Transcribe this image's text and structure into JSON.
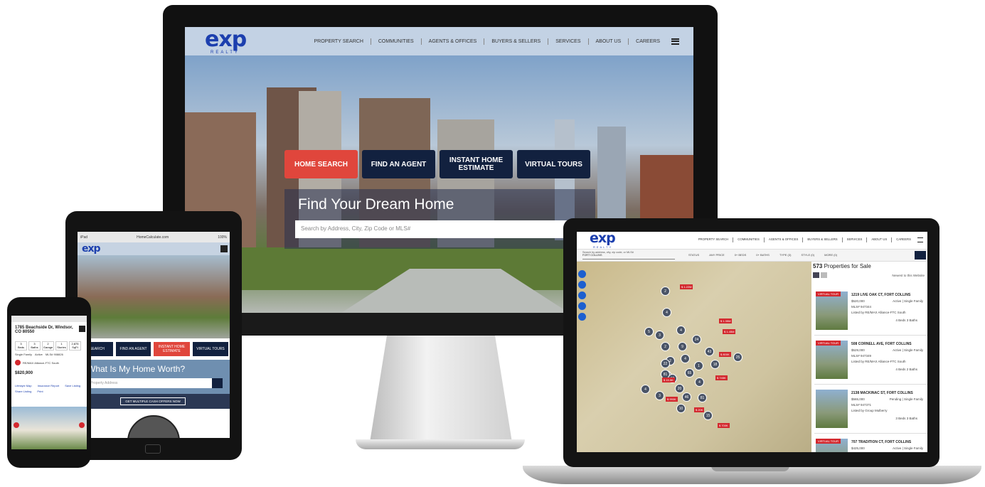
{
  "desktop": {
    "logo": "exp",
    "logo_sub": "REALTY",
    "nav": [
      "PROPERTY SEARCH",
      "COMMUNITIES",
      "AGENTS & OFFICES",
      "BUYERS & SELLERS",
      "SERVICES",
      "ABOUT US",
      "CAREERS"
    ],
    "tabs": [
      "HOME SEARCH",
      "FIND AN AGENT",
      "INSTANT HOME ESTIMATE",
      "VIRTUAL TOURS"
    ],
    "heading": "Find Your Dream Home",
    "search_placeholder": "Search by Address, City, Zip Code or MLS#"
  },
  "tablet": {
    "status": "iPad",
    "url": "HomeCalculate.com",
    "battery": "100%",
    "logo": "exp",
    "tabs": [
      "R SEARCH",
      "FIND AN AGENT",
      "INSTANT HOME ESTIMATE",
      "VIRTUAL TOURS"
    ],
    "heading": "What Is My Home Worth?",
    "input_placeholder": "Property Address",
    "offers_button": "GET MULTIPLE CASH OFFERS NOW"
  },
  "phone": {
    "address": "1785 Beachside Dr, Windsor, CO 80550",
    "stats": [
      {
        "v": "3",
        "l": "Beds"
      },
      {
        "v": "3",
        "l": "Baths"
      },
      {
        "v": "2",
        "l": "Garage"
      },
      {
        "v": "1",
        "l": "Stories"
      },
      {
        "v": "2,875",
        "l": "SqFt"
      }
    ],
    "type": "Single Family",
    "status": "Active",
    "mls": "MLS# 908826",
    "broker": "RE/MAX Alliance-FTC South",
    "price": "$820,900",
    "links": [
      "Lifestyle Map",
      "Insurance Report",
      "Save Listing",
      "Share Listing",
      "Print"
    ]
  },
  "laptop": {
    "logo": "exp",
    "logo_sub": "REALTY",
    "nav": [
      "PROPERTY SEARCH",
      "COMMUNITIES",
      "AGENTS & OFFICES",
      "BUYERS & SELLERS",
      "SERVICES",
      "ABOUT US",
      "CAREERS"
    ],
    "search_hint": "Search by address, city, zip code, or MLS#",
    "search_value": "FORT COLLINS",
    "filters": [
      "STATUS",
      "ANY PRICE",
      "0+ BEDS",
      "0+ BATHS",
      "TYPE (3)",
      "STYLE (0)",
      "MORE (0)"
    ],
    "count": "573",
    "count_label": "Properties for Sale",
    "sort": "Newest to this Website",
    "listings": [
      {
        "address": "1219 LIVE OAK CT, FORT COLLINS",
        "price": "$520,000",
        "status": "Active | Single Family",
        "mls": "MLS# 947344",
        "broker": "Listed by RE/MAX Alliance-FTC South",
        "beds": "4",
        "baths": "3",
        "badge": "VIRTUAL TOUR"
      },
      {
        "address": "508 CORNELL AVE, FORT COLLINS",
        "price": "$529,000",
        "status": "Active | Single Family",
        "mls": "MLS# 947349",
        "broker": "Listed by RE/MAX Alliance-FTC South",
        "beds": "4",
        "baths": "2",
        "badge": "VIRTUAL TOUR"
      },
      {
        "address": "2138 MACKINAC ST, FORT COLLINS",
        "price": "$565,000",
        "status": "Pending | Single Family",
        "mls": "MLS# 947371",
        "broker": "Listed by Group Mulberry",
        "beds": "3",
        "baths": "3",
        "badge": ""
      },
      {
        "address": "707 TRADITION CT, FORT COLLINS",
        "price": "$425,000",
        "status": "Active | Single Family",
        "mls": "",
        "broker": "",
        "beds": "",
        "baths": "",
        "badge": "VIRTUAL TOUR"
      }
    ],
    "beds_label": "Beds",
    "baths_label": "Baths",
    "clusters": [
      "2",
      "4",
      "5",
      "3",
      "4",
      "24",
      "2",
      "9",
      "43",
      "2",
      "4",
      "22",
      "20",
      "65",
      "1",
      "18",
      "81",
      "19",
      "4",
      "4",
      "20",
      "46",
      "81",
      "25",
      "3",
      "10",
      "15"
    ],
    "price_tags": [
      "$ 1.22M",
      "$ 1.35M",
      "$ 1.45M",
      "$ 800K",
      "$ 745K",
      "$ 15.5K",
      "$ 990K",
      "$ 20K",
      "$ 700K"
    ]
  },
  "colors": {
    "brand": "#1c3fae",
    "navy": "#12213f",
    "red": "#e0463c"
  }
}
